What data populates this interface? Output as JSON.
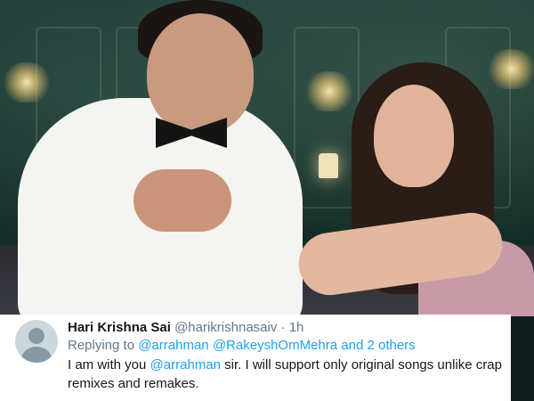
{
  "tweet": {
    "display_name": "Hari Krishna Sai",
    "handle": "@harikrishnasaiv",
    "separator": "·",
    "time": "1h",
    "replying_prefix": "Replying to",
    "replying_to": [
      "@arrahman",
      "@RakeyshOmMehra",
      "and 2 others"
    ],
    "body_start": "I am with you",
    "body_mention": "@arrahman",
    "body_end": "sir. I will support only original songs unlike crap remixes and remakes."
  },
  "colors": {
    "link": "#1da1f2",
    "secondary_text": "#657786",
    "primary_text": "#14171a",
    "card_bg": "#ffffff"
  },
  "icons": [
    "default-avatar-icon"
  ]
}
